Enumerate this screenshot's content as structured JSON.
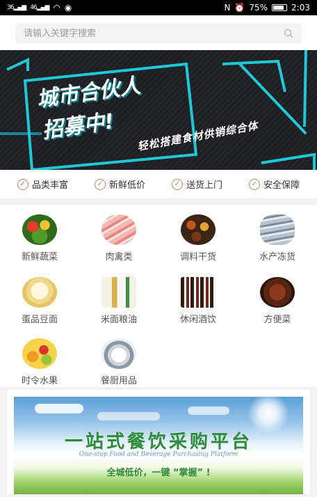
{
  "status_bar": {
    "signal1": "36",
    "signal2": "46",
    "nfc": "N",
    "battery": "75%",
    "time": "2:03"
  },
  "search": {
    "placeholder": "请输入关键字搜索"
  },
  "banner": {
    "line1": "城市合伙人",
    "line2": "招募中!",
    "subtitle": "轻松搭建食材供销综合体"
  },
  "features": [
    {
      "label": "品类丰富"
    },
    {
      "label": "新鲜低价"
    },
    {
      "label": "送货上门"
    },
    {
      "label": "安全保障"
    }
  ],
  "categories": [
    {
      "label": "新鲜蔬菜",
      "icon": "vegetables-icon"
    },
    {
      "label": "肉禽类",
      "icon": "meat-icon"
    },
    {
      "label": "调料干货",
      "icon": "spices-icon"
    },
    {
      "label": "水产冻货",
      "icon": "fish-icon"
    },
    {
      "label": "蛋品豆面",
      "icon": "eggs-icon"
    },
    {
      "label": "米面粮油",
      "icon": "grain-oil-icon"
    },
    {
      "label": "休闲酒饮",
      "icon": "drinks-icon"
    },
    {
      "label": "方便菜",
      "icon": "prepared-food-icon"
    },
    {
      "label": "时令水果",
      "icon": "fruit-icon"
    },
    {
      "label": "餐厨用品",
      "icon": "kitchenware-icon"
    }
  ],
  "promo": {
    "title": "一站式餐饮采购平台",
    "title_en": "One-stop Food and Beverage Purchasing Platform",
    "subtitle": "全城低价，一键 “掌握” !"
  },
  "colors": {
    "accent_teal": "#1ec8d8",
    "feature_check": "#b88a5c",
    "promo_green": "#2e8b3a"
  }
}
